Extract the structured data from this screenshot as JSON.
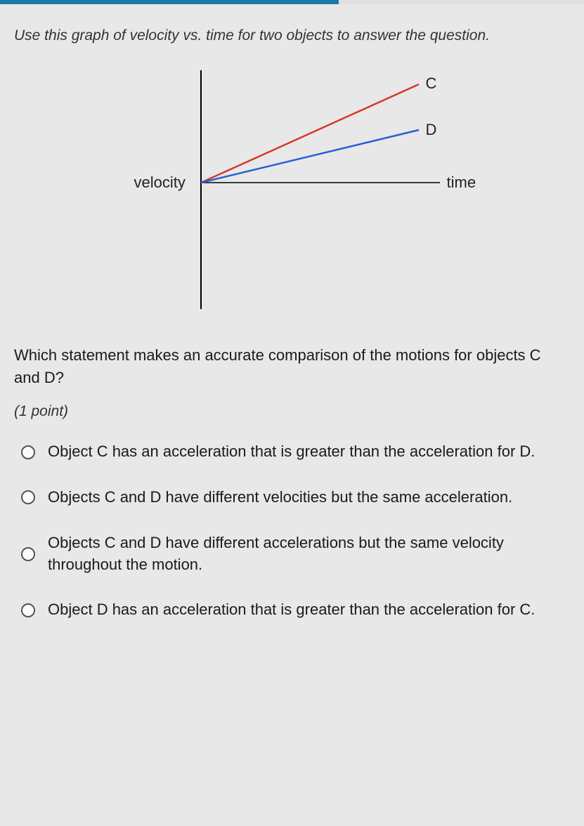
{
  "progress_pct": 58,
  "instruction": "Use this graph of velocity vs. time for two objects to answer the question.",
  "chart_data": {
    "type": "line",
    "xlabel": "time",
    "ylabel": "velocity",
    "series": [
      {
        "name": "C",
        "color": "#d43a2a",
        "points": [
          [
            0,
            0
          ],
          [
            1,
            0.55
          ]
        ]
      },
      {
        "name": "D",
        "color": "#2a5fd4",
        "points": [
          [
            0,
            0
          ],
          [
            1,
            0.3
          ]
        ]
      }
    ],
    "axes": {
      "x_range": [
        0,
        1
      ],
      "y_range": [
        -1,
        1
      ]
    }
  },
  "labels": {
    "velocity": "velocity",
    "time": "time",
    "C": "C",
    "D": "D"
  },
  "question": "Which statement makes an accurate comparison of the motions for objects C and D?",
  "points_label": "(1 point)",
  "options": [
    "Object C has an acceleration that is greater than the acceleration for D.",
    "Objects C and D have different velocities but the same acceleration.",
    "Objects C and D have different accelerations but the same velocity throughout the motion.",
    "Object D has an acceleration that is greater than the acceleration for C."
  ]
}
